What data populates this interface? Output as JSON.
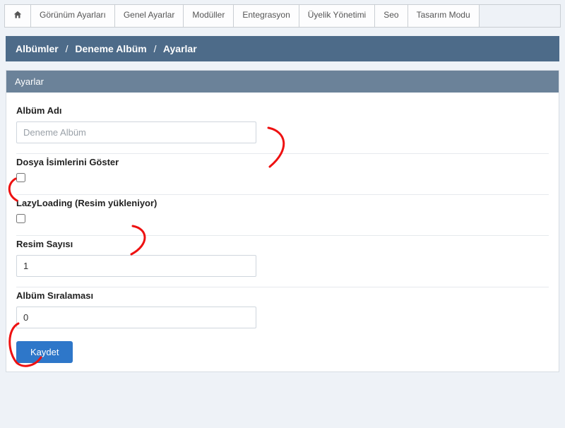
{
  "nav": {
    "items": [
      "Görünüm Ayarları",
      "Genel Ayarlar",
      "Modüller",
      "Entegrasyon",
      "Üyelik Yönetimi",
      "Seo",
      "Tasarım Modu"
    ]
  },
  "breadcrumb": {
    "items": [
      "Albümler",
      "Deneme Albüm",
      "Ayarlar"
    ],
    "sep": "/"
  },
  "panel": {
    "title": "Ayarlar"
  },
  "form": {
    "album_name": {
      "label": "Albüm Adı",
      "value": "Deneme Albüm"
    },
    "show_filenames": {
      "label": "Dosya İsimlerini Göster",
      "checked": false
    },
    "lazy_loading": {
      "label": "LazyLoading (Resim yükleniyor)",
      "checked": false
    },
    "image_count": {
      "label": "Resim Sayısı",
      "value": "1"
    },
    "album_order": {
      "label": "Albüm Sıralaması",
      "value": "0"
    },
    "save_label": "Kaydet"
  }
}
